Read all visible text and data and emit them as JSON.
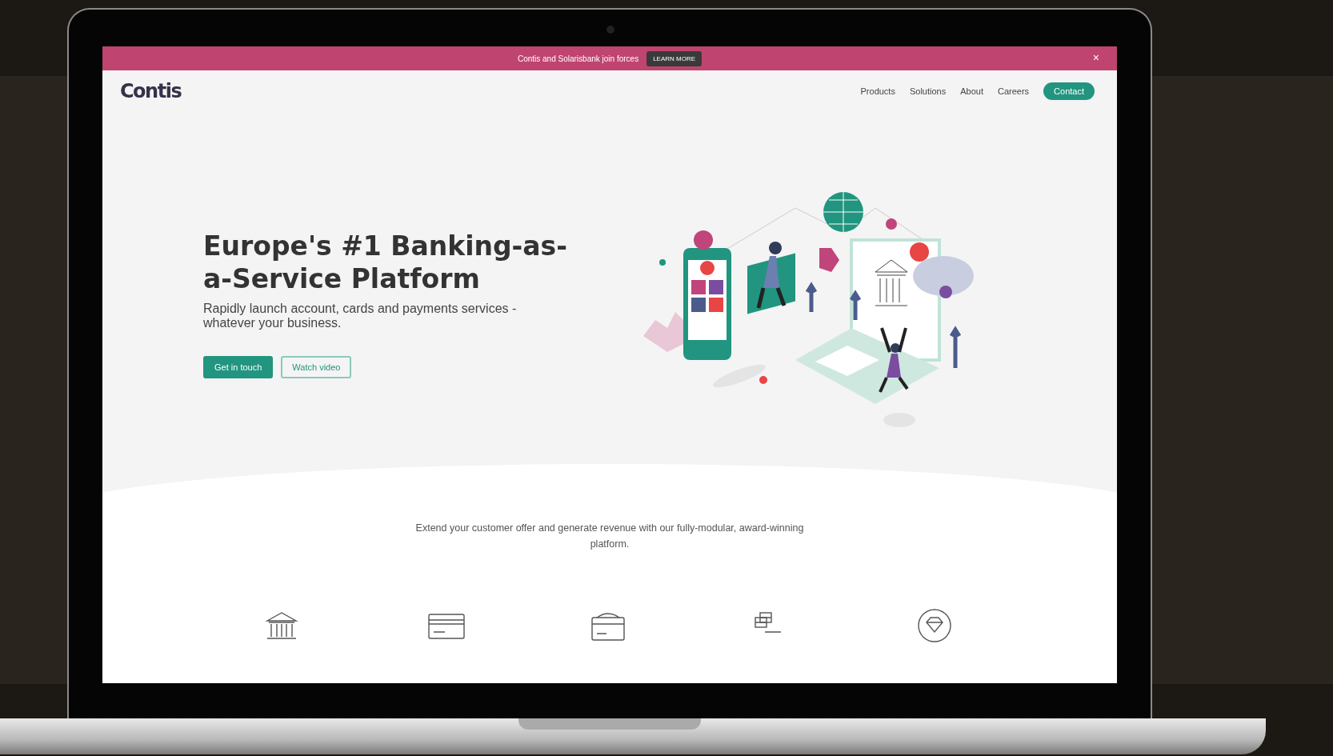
{
  "banner": {
    "text": "Contis and Solarisbank join forces",
    "button": "LEARN MORE",
    "close": "×"
  },
  "nav": {
    "logo": "Contis",
    "links": [
      {
        "label": "Products"
      },
      {
        "label": "Solutions"
      },
      {
        "label": "About"
      },
      {
        "label": "Careers"
      }
    ],
    "contact": "Contact"
  },
  "hero": {
    "title": "Europe's #1 Banking-as-a-Service Platform",
    "subtitle": "Rapidly launch account, cards and payments services - whatever your business.",
    "buttons": [
      {
        "label": "Get in touch",
        "kind": "primary"
      },
      {
        "label": "Watch video",
        "kind": "outline"
      }
    ]
  },
  "intro": {
    "text": "Extend your customer offer and generate revenue with our fully-modular, award-winning platform."
  },
  "features": [
    {
      "kind": "bank"
    },
    {
      "kind": "card"
    },
    {
      "kind": "wallet"
    },
    {
      "kind": "stack"
    },
    {
      "kind": "diamond"
    }
  ]
}
